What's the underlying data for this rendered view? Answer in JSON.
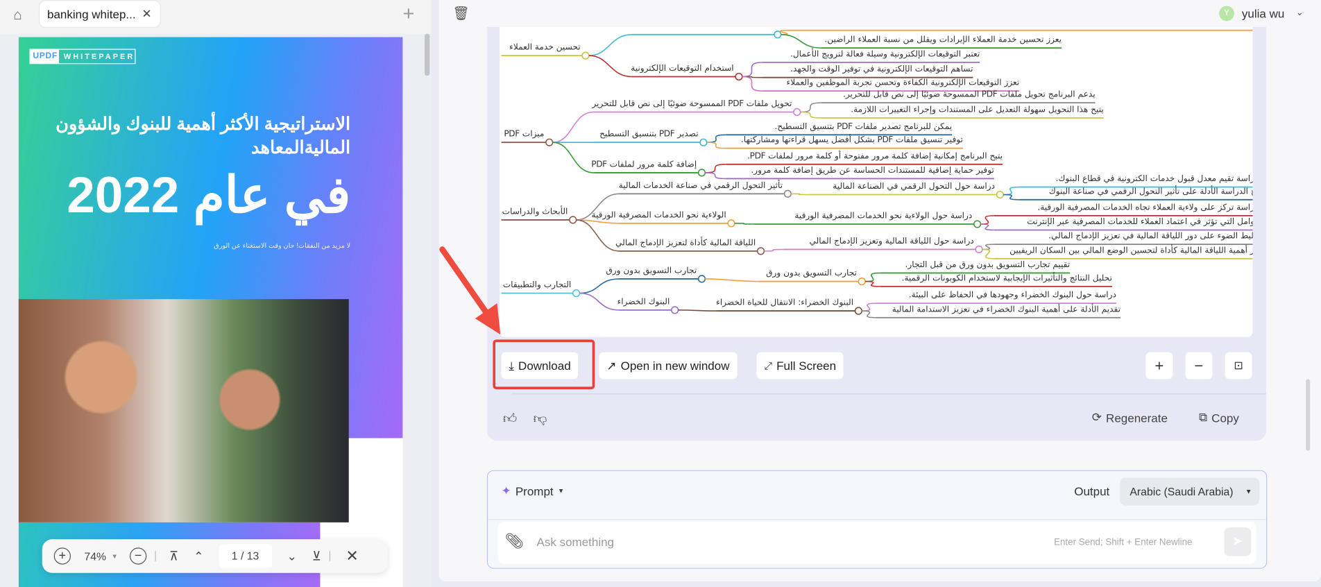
{
  "left_panel": {
    "home_icon": "home-icon",
    "tab_title": "banking whitep...",
    "pdf": {
      "logo_brand": "UPDF",
      "logo_label": "WHITEPAPER",
      "headline": "الاستراتيجية الأكثر أهمية للبنوك والشؤون الماليةالمعاهد",
      "year_line": "في عام 2022",
      "subtitle": "لا مزيد من النفقات! حان وقت الاستغناء عن الورق"
    },
    "zoom_toolbar": {
      "zoom_level": "74%",
      "current_page": "1",
      "page_separator": "/",
      "total_pages": "13"
    }
  },
  "right_panel": {
    "user": {
      "initial": "Y",
      "name": "yulia wu",
      "avatar_color": "#b8e6a6"
    },
    "mindmap": {
      "nodes": [
        "تحسين خدمة العملاء",
        "يعزز تحسين خدمة العملاء الإيرادات ويقلل من نسبة العملاء الراضين.",
        "استخدام التوقيعات الإلكترونية",
        "تعتبر التوقيعات الإلكترونية وسيلة فعالة لترويج الأعمال.",
        "تساهم التوقيعات الإلكترونية في توفير الوقت والجهد.",
        "تعزز التوقيعات الإلكترونية الكفاءة وتحسن تجربة الموظفين والعملاء",
        "ميزات PDF",
        "تحويل ملفات PDF الممسوحة ضوئيًا إلى نص قابل للتحرير",
        "يدعم البرنامج تحويل ملفات PDF الممسوحة ضوئيًا إلى نص قابل للتحرير.",
        "يتيح هذا التحويل سهولة التعديل على المستندات وإجراء التغييرات اللازمة.",
        "تصدير PDF بتنسيق التسطيح",
        "يمكن للبرنامج تصدير ملفات PDF بتنسيق التسطيح.",
        "توفير تنسيق ملفات PDF بشكل أفضل يسهل قراءتها ومشاركتها.",
        "إضافة كلمة مرور لملفات PDF",
        "يتيح البرنامج إمكانية إضافة كلمة مرور مفتوحة أو كلمة مرور لملفات PDF.",
        "توفير حماية إضافية للمستندات الحساسة عن طريق إضافة كلمة مرور.",
        "الأبحاث والدراسات",
        "تأثير التحول الرقمي في صناعة الخدمات المالية",
        "دراسة حول التحول الرقمي في الصناعة المالية",
        "الدراسة تقيم معدل قبول خدمات الكترونية في قطاع البنوك.",
        "تتيح الدراسة الأدلة على تأثير التحول الرقمي في صناعة البنوك",
        "الولاءية نحو الخدمات المصرفية الورقية",
        "دراسة حول الولاءية نحو الخدمات المصرفية الورقية",
        "الدراسة تركز على ولاءية العملاء تجاه الخدمات المصرفية الورقية.",
        "العوامل التي تؤثر في اعتماد العملاء للخدمات المصرفية عبر الإنترنت",
        "اللياقة المالية كأداة لتعزيز الإدماج المالي",
        "دراسة حول اللياقة المالية وتعزيز الإدماج المالي",
        "تسليط الضوء على دور اللياقة المالية في تعزيز الإدماج المالي.",
        "تبرز أهمية اللياقة المالية كأداة لتحسين الوضع المالي بين السكان الريفيين",
        "التجارب والتطبيقات",
        "تجارب التسويق بدون ورق",
        "تجارب التسويق بدون ورق",
        "تقييم تجارب التسويق بدون ورق من قبل التجار.",
        "تحليل النتائج والتأثيرات الإيجابية لاستخدام الكوبونات الرقمية.",
        "البنوك الخضراء",
        "البنوك الخضراء: الانتقال للحياة الخضراء",
        "دراسة حول البنوك الخضراء وجهودها في الحفاظ على البيئة.",
        "تقديم الأدلة على أهمية البنوك الخضراء في تعزيز الاستدامة المالية"
      ]
    },
    "toolbar": {
      "download": "Download",
      "open_new_window": "Open in new window",
      "full_screen": "Full Screen"
    },
    "actions": {
      "regenerate": "Regenerate",
      "copy": "Copy"
    },
    "prompt": {
      "mode_label": "Prompt",
      "output_label": "Output",
      "output_language": "Arabic (Saudi Arabia)",
      "placeholder": "Ask something",
      "hint": "Enter Send; Shift + Enter Newline"
    },
    "highlight_color": "#e8403a",
    "card_color": "#e8e7f6"
  }
}
